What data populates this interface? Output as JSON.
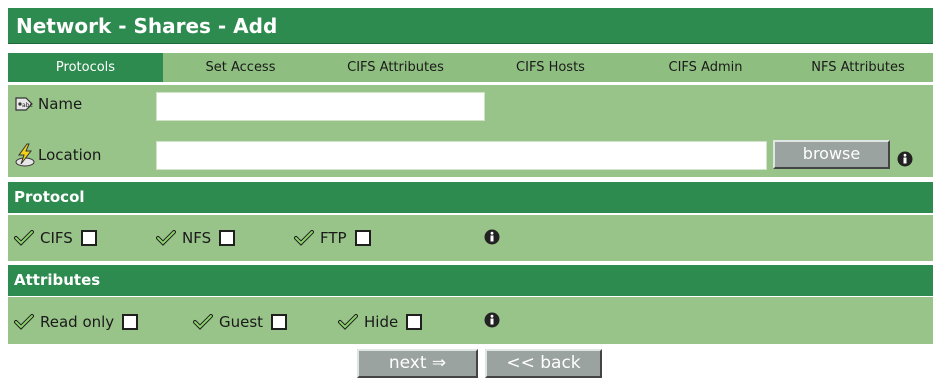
{
  "title": "Network - Shares - Add",
  "tabs": [
    {
      "label": "Protocols",
      "active": true
    },
    {
      "label": "Set Access",
      "active": false
    },
    {
      "label": "CIFS Attributes",
      "active": false
    },
    {
      "label": "CIFS Hosts",
      "active": false
    },
    {
      "label": "CIFS Admin",
      "active": false
    },
    {
      "label": "NFS Attributes",
      "active": false
    }
  ],
  "fields": {
    "name": {
      "label": "Name",
      "value": "",
      "icon": "name-tag-icon"
    },
    "location": {
      "label": "Location",
      "value": "",
      "icon": "location-lightning-icon"
    },
    "browse_label": "browse"
  },
  "protocol": {
    "header": "Protocol",
    "options": [
      {
        "label": "CIFS",
        "checked": false
      },
      {
        "label": "NFS",
        "checked": false
      },
      {
        "label": "FTP",
        "checked": false
      }
    ]
  },
  "attributes": {
    "header": "Attributes",
    "options": [
      {
        "label": "Read only",
        "checked": false
      },
      {
        "label": "Guest",
        "checked": false
      },
      {
        "label": "Hide",
        "checked": false
      }
    ]
  },
  "buttons": {
    "next": "next ⇒",
    "back": "<< back"
  },
  "colors": {
    "header_green": "#2e8b4f",
    "row_green": "#98c48a",
    "tab_bar": "#8fbf80",
    "button_gray": "#9aa3a0"
  }
}
